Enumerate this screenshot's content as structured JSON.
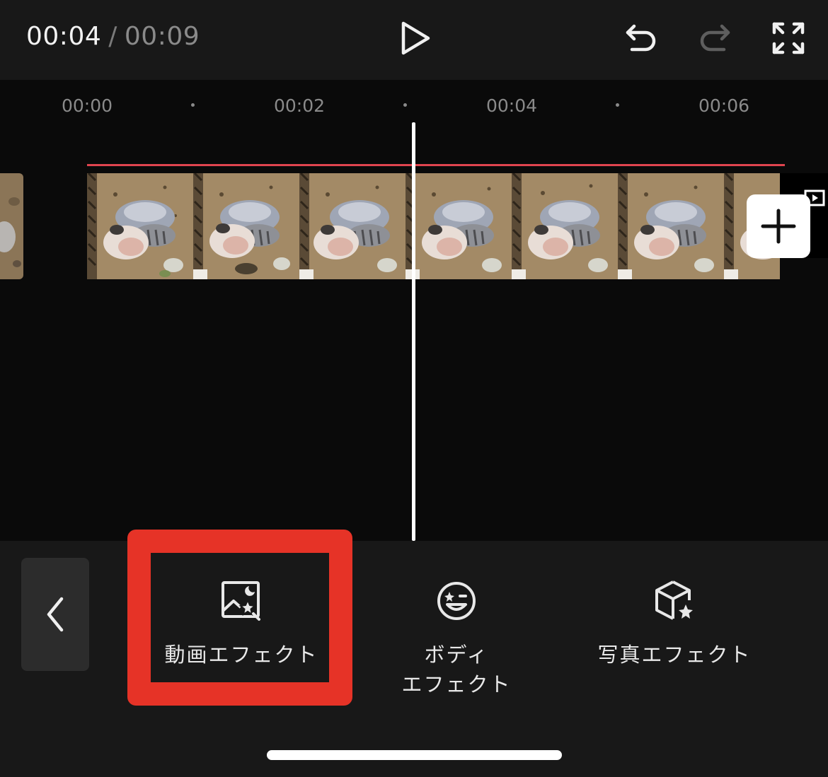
{
  "header": {
    "current_time": "00:04",
    "separator": "/",
    "total_time": "00:09",
    "icons": {
      "play": "play-icon",
      "undo": "undo-icon",
      "redo": "redo-icon",
      "fullscreen": "fullscreen-icon"
    }
  },
  "timeline": {
    "ticks": [
      "00:00",
      "00:02",
      "00:04",
      "00:06"
    ],
    "accent_color": "#e0444f",
    "add_icon": "plus-icon",
    "cover_icon": "play-square-icon"
  },
  "effects_menu": {
    "back_icon": "chevron-left-icon",
    "highlight_color": "#e63327",
    "items": [
      {
        "label": "動画エフェクト",
        "icon": "image-sparkle-icon"
      },
      {
        "label_line1": "ボディ",
        "label_line2": "エフェクト",
        "icon": "face-sparkle-icon"
      },
      {
        "label": "写真エフェクト",
        "icon": "cube-sparkle-icon"
      }
    ]
  }
}
